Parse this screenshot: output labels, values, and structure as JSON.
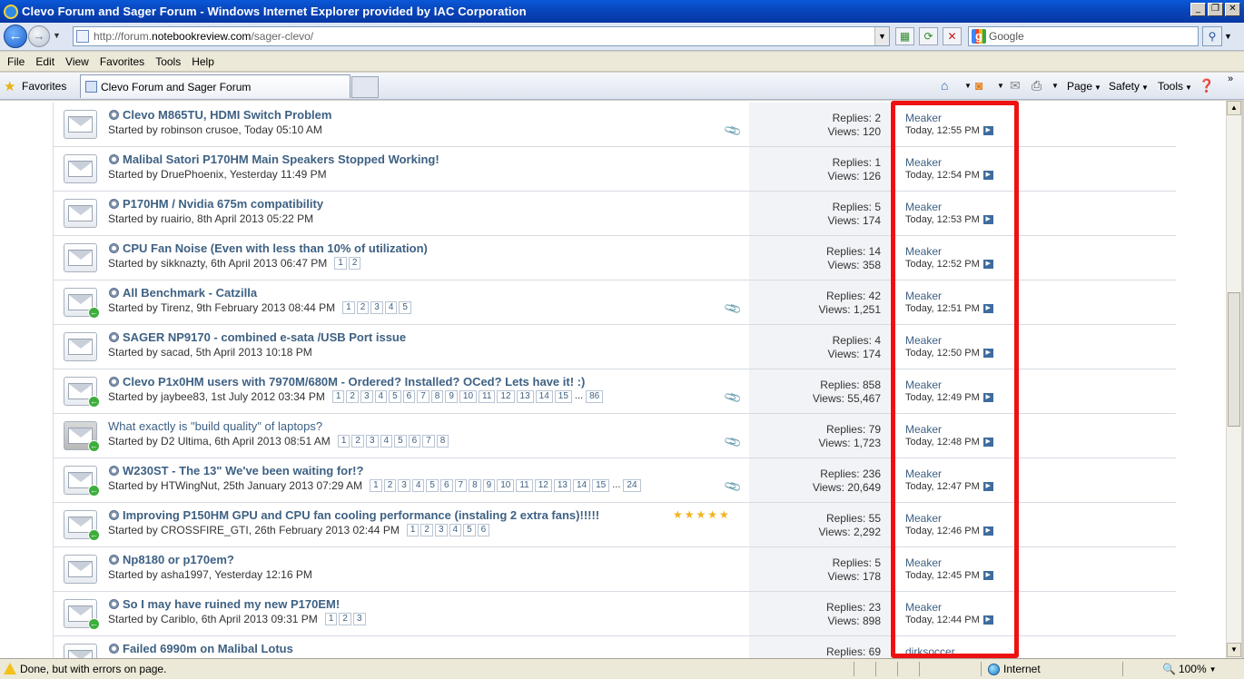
{
  "window": {
    "title": "Clevo Forum and Sager Forum - Windows Internet Explorer provided by IAC Corporation",
    "min_glyph": "_",
    "max_glyph": "❐",
    "close_glyph": "✕"
  },
  "address": {
    "url_prefix": "http://forum.",
    "url_domain": "notebookreview.com",
    "url_suffix": "/sager-clevo/",
    "search_placeholder": "Google"
  },
  "menu": [
    "File",
    "Edit",
    "View",
    "Favorites",
    "Tools",
    "Help"
  ],
  "favorites": {
    "label": "Favorites",
    "tab_title": "Clevo Forum and Sager Forum"
  },
  "commands": [
    "Page",
    "Safety",
    "Tools"
  ],
  "threads": [
    {
      "title": "Clevo M865TU, HDMI Switch Problem",
      "starter": "Started by robinson crusoe, Today 05:10 AM",
      "pages": [],
      "replies": "Replies: 2",
      "views": "Views: 120",
      "last_user": "Meaker",
      "last_date": "Today, 12:55 PM",
      "attach": true,
      "arrow": false,
      "gray": false,
      "bold": true,
      "stars": false
    },
    {
      "title": "Malibal Satori P170HM Main Speakers Stopped Working!",
      "starter": "Started by DruePhoenix, Yesterday 11:49 PM",
      "pages": [],
      "replies": "Replies: 1",
      "views": "Views: 126",
      "last_user": "Meaker",
      "last_date": "Today, 12:54 PM",
      "attach": false,
      "arrow": false,
      "gray": false,
      "bold": true,
      "stars": false
    },
    {
      "title": "P170HM / Nvidia 675m compatibility",
      "starter": "Started by ruairio, 8th April 2013 05:22 PM",
      "pages": [],
      "replies": "Replies: 5",
      "views": "Views: 174",
      "last_user": "Meaker",
      "last_date": "Today, 12:53 PM",
      "attach": false,
      "arrow": false,
      "gray": false,
      "bold": true,
      "stars": false
    },
    {
      "title": "CPU Fan Noise (Even with less than 10% of utilization)",
      "starter": "Started by sikknazty, 6th April 2013 06:47 PM",
      "pages": [
        "1",
        "2"
      ],
      "replies": "Replies: 14",
      "views": "Views: 358",
      "last_user": "Meaker",
      "last_date": "Today, 12:52 PM",
      "attach": false,
      "arrow": false,
      "gray": false,
      "bold": true,
      "stars": false
    },
    {
      "title": "All Benchmark - Catzilla",
      "starter": "Started by Tirenz, 9th February 2013 08:44 PM",
      "pages": [
        "1",
        "2",
        "3",
        "4",
        "5"
      ],
      "replies": "Replies: 42",
      "views": "Views: 1,251",
      "last_user": "Meaker",
      "last_date": "Today, 12:51 PM",
      "attach": true,
      "arrow": true,
      "gray": false,
      "bold": true,
      "stars": false
    },
    {
      "title": "SAGER NP9170 - combined e-sata /USB Port issue",
      "starter": "Started by sacad, 5th April 2013 10:18 PM",
      "pages": [],
      "replies": "Replies: 4",
      "views": "Views: 174",
      "last_user": "Meaker",
      "last_date": "Today, 12:50 PM",
      "attach": false,
      "arrow": false,
      "gray": false,
      "bold": true,
      "stars": false
    },
    {
      "title": "Clevo P1x0HM users with 7970M/680M - Ordered? Installed? OCed? Lets have it! :)",
      "starter": "Started by jaybee83, 1st July 2012 03:34 PM",
      "pages": [
        "1",
        "2",
        "3",
        "4",
        "5",
        "6",
        "7",
        "8",
        "9",
        "10",
        "11",
        "12",
        "13",
        "14",
        "15",
        "...",
        "86"
      ],
      "replies": "Replies: 858",
      "views": "Views: 55,467",
      "last_user": "Meaker",
      "last_date": "Today, 12:49 PM",
      "attach": true,
      "arrow": true,
      "gray": false,
      "bold": true,
      "stars": false
    },
    {
      "title": "What exactly is \"build quality\" of laptops?",
      "starter": "Started by D2 Ultima, 6th April 2013 08:51 AM",
      "pages": [
        "1",
        "2",
        "3",
        "4",
        "5",
        "6",
        "7",
        "8"
      ],
      "replies": "Replies: 79",
      "views": "Views: 1,723",
      "last_user": "Meaker",
      "last_date": "Today, 12:48 PM",
      "attach": true,
      "arrow": true,
      "gray": true,
      "bold": false,
      "stars": false
    },
    {
      "title": "W230ST - The 13\" We've been waiting for!?",
      "starter": "Started by HTWingNut, 25th January 2013 07:29 AM",
      "pages": [
        "1",
        "2",
        "3",
        "4",
        "5",
        "6",
        "7",
        "8",
        "9",
        "10",
        "11",
        "12",
        "13",
        "14",
        "15",
        "...",
        "24"
      ],
      "replies": "Replies: 236",
      "views": "Views: 20,649",
      "last_user": "Meaker",
      "last_date": "Today, 12:47 PM",
      "attach": true,
      "arrow": true,
      "gray": false,
      "bold": true,
      "stars": false
    },
    {
      "title": "Improving P150HM GPU and CPU fan cooling performance (instaling 2 extra fans)!!!!!",
      "starter": "Started by CROSSFIRE_GTI, 26th February 2013 02:44 PM",
      "pages": [
        "1",
        "2",
        "3",
        "4",
        "5",
        "6"
      ],
      "replies": "Replies: 55",
      "views": "Views: 2,292",
      "last_user": "Meaker",
      "last_date": "Today, 12:46 PM",
      "attach": false,
      "arrow": true,
      "gray": false,
      "bold": true,
      "stars": true
    },
    {
      "title": "Np8180 or p170em?",
      "starter": "Started by asha1997, Yesterday 12:16 PM",
      "pages": [],
      "replies": "Replies: 5",
      "views": "Views: 178",
      "last_user": "Meaker",
      "last_date": "Today, 12:45 PM",
      "attach": false,
      "arrow": false,
      "gray": false,
      "bold": true,
      "stars": false
    },
    {
      "title": "So I may have ruined my new P170EM!",
      "starter": "Started by Cariblo, 6th April 2013 09:31 PM",
      "pages": [
        "1",
        "2",
        "3"
      ],
      "replies": "Replies: 23",
      "views": "Views: 898",
      "last_user": "Meaker",
      "last_date": "Today, 12:44 PM",
      "attach": false,
      "arrow": true,
      "gray": false,
      "bold": true,
      "stars": false
    },
    {
      "title": "Failed 6990m on Malibal Lotus",
      "starter": "",
      "pages": [],
      "replies": "Replies: 69",
      "views": "",
      "last_user": "dirksoccer",
      "last_date": "",
      "attach": false,
      "arrow": false,
      "gray": false,
      "bold": true,
      "stars": false
    }
  ],
  "status": {
    "text": "Done, but with errors on page.",
    "zone": "Internet",
    "zoom": "100%"
  },
  "colors": {
    "highlight": "#ee1111",
    "link": "#3e6183"
  }
}
